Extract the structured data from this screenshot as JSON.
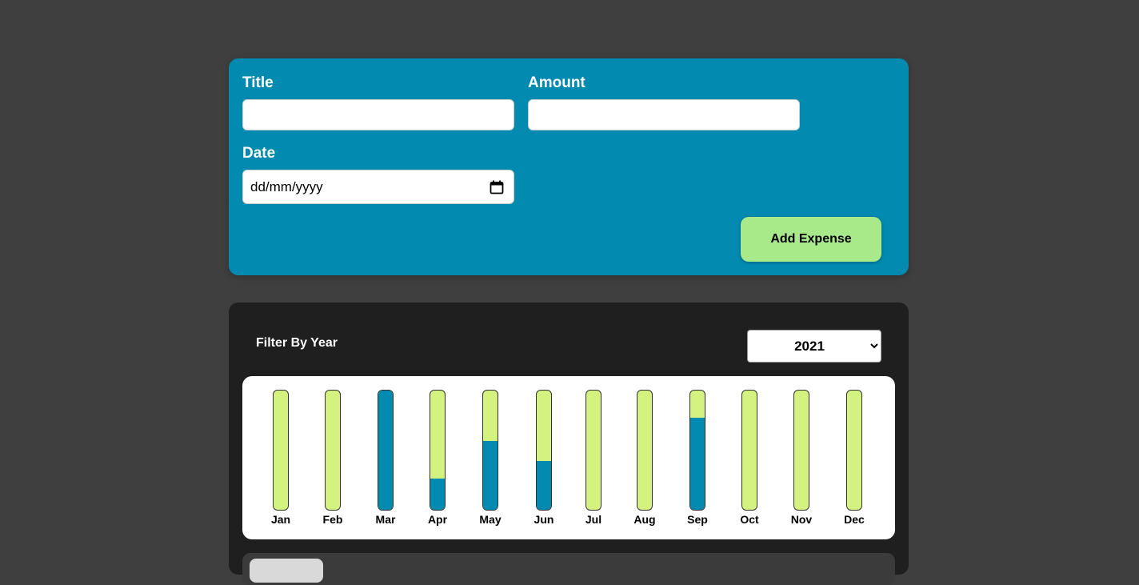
{
  "form": {
    "title_label": "Title",
    "title_value": "",
    "amount_label": "Amount",
    "amount_value": "",
    "date_label": "Date",
    "date_placeholder": "dd/mm/yyyy",
    "submit_label": "Add Expense"
  },
  "filter": {
    "label": "Filter By Year",
    "selected_year": "2021"
  },
  "chart_data": {
    "type": "bar",
    "categories": [
      "Jan",
      "Feb",
      "Mar",
      "Apr",
      "May",
      "Jun",
      "Jul",
      "Aug",
      "Sep",
      "Oct",
      "Nov",
      "Dec"
    ],
    "values": [
      0,
      0,
      1.0,
      0.26,
      0.58,
      0.41,
      0,
      0,
      0.77,
      0,
      0,
      0
    ],
    "ylim": [
      0,
      1
    ]
  },
  "colors": {
    "form_background": "#028ab1",
    "bar_fill": "#028ab1",
    "bar_track": "#d3f27f",
    "button": "#a8e98a"
  }
}
